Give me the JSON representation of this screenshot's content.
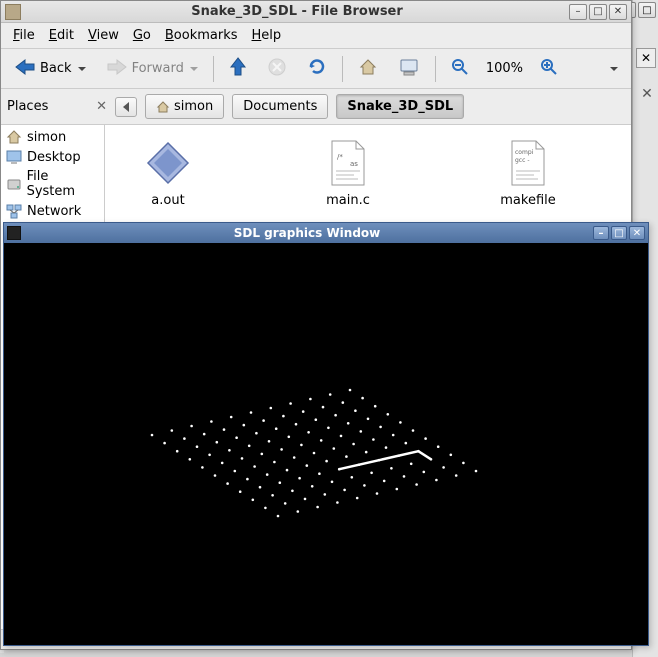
{
  "filebrowser": {
    "title": "Snake_3D_SDL - File Browser",
    "menu": {
      "file": "File",
      "edit": "Edit",
      "view": "View",
      "go": "Go",
      "bookmarks": "Bookmarks",
      "help": "Help"
    },
    "toolbar": {
      "back": "Back",
      "forward": "Forward",
      "zoom": "100%"
    },
    "places_label": "Places",
    "crumbs": {
      "root": "simon",
      "documents": "Documents",
      "current": "Snake_3D_SDL"
    },
    "sidebar": [
      {
        "icon": "home",
        "label": "simon"
      },
      {
        "icon": "desktop",
        "label": "Desktop"
      },
      {
        "icon": "disk",
        "label": "File System"
      },
      {
        "icon": "network",
        "label": "Network"
      }
    ],
    "files": [
      {
        "icon": "exec",
        "label": "a.out"
      },
      {
        "icon": "csrc",
        "label": "main.c"
      },
      {
        "icon": "make",
        "label": "makefile"
      }
    ]
  },
  "sdl": {
    "title": "SDL graphics Window"
  }
}
